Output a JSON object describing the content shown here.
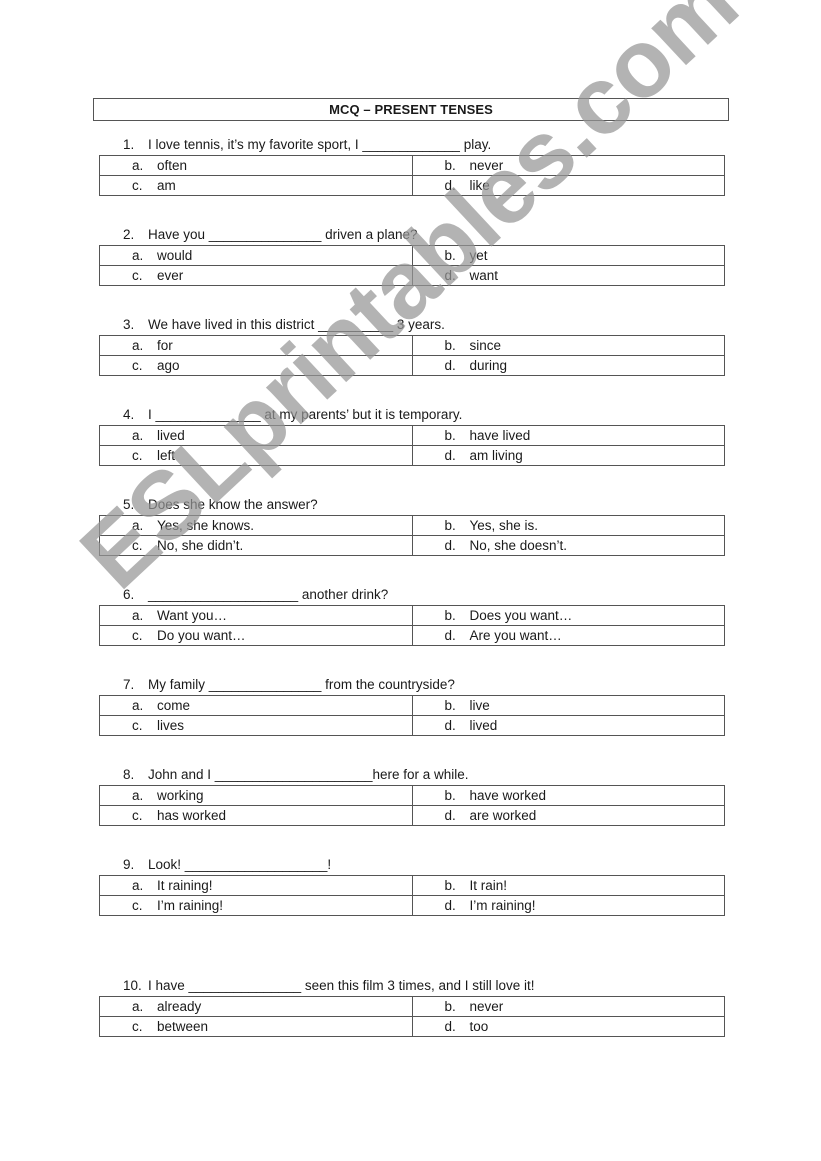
{
  "worksheet": {
    "title": "MCQ – PRESENT TENSES",
    "watermark": "ESLprintables.com",
    "questions": [
      {
        "number": "1.",
        "stem": "I love tennis, it’s my favorite sport, I _____________ play.",
        "options": [
          {
            "letter": "a.",
            "text": "often"
          },
          {
            "letter": "b.",
            "text": "never"
          },
          {
            "letter": "c.",
            "text": "am"
          },
          {
            "letter": "d.",
            "text": "like"
          }
        ]
      },
      {
        "number": "2.",
        "stem": "Have you _______________ driven a plane?",
        "options": [
          {
            "letter": "a.",
            "text": "would"
          },
          {
            "letter": "b.",
            "text": "yet"
          },
          {
            "letter": "c.",
            "text": "ever"
          },
          {
            "letter": "d.",
            "text": "want"
          }
        ]
      },
      {
        "number": "3.",
        "stem": "We have lived in this district __________ 3 years.",
        "options": [
          {
            "letter": "a.",
            "text": "for"
          },
          {
            "letter": "b.",
            "text": "since"
          },
          {
            "letter": "c.",
            "text": "ago"
          },
          {
            "letter": "d.",
            "text": "during"
          }
        ]
      },
      {
        "number": "4.",
        "stem": "I ______________ at my parents’ but it is temporary.",
        "options": [
          {
            "letter": "a.",
            "text": "lived"
          },
          {
            "letter": "b.",
            "text": "have lived"
          },
          {
            "letter": "c.",
            "text": "left"
          },
          {
            "letter": "d.",
            "text": "am living"
          }
        ]
      },
      {
        "number": "5.",
        "stem": "Does she know the answer?",
        "options": [
          {
            "letter": "a.",
            "text": "Yes, she knows."
          },
          {
            "letter": "b.",
            "text": "Yes, she is."
          },
          {
            "letter": "c.",
            "text": "No, she didn’t."
          },
          {
            "letter": "d.",
            "text": "No, she doesn’t."
          }
        ]
      },
      {
        "number": "6.",
        "stem": "____________________ another drink?",
        "options": [
          {
            "letter": "a.",
            "text": "Want you…"
          },
          {
            "letter": "b.",
            "text": "Does you want…"
          },
          {
            "letter": "c.",
            "text": "Do you want…"
          },
          {
            "letter": "d.",
            "text": "Are you want…"
          }
        ]
      },
      {
        "number": "7.",
        "stem": "My family _______________ from the countryside?",
        "options": [
          {
            "letter": "a.",
            "text": "come"
          },
          {
            "letter": "b.",
            "text": "live"
          },
          {
            "letter": "c.",
            "text": "lives"
          },
          {
            "letter": "d.",
            "text": "lived"
          }
        ]
      },
      {
        "number": "8.",
        "stem": "John and I _____________________here for a while.",
        "options": [
          {
            "letter": "a.",
            "text": "working"
          },
          {
            "letter": "b.",
            "text": "have worked"
          },
          {
            "letter": "c.",
            "text": "has worked"
          },
          {
            "letter": "d.",
            "text": "are worked"
          }
        ]
      },
      {
        "number": "9.",
        "stem": "Look! ___________________!",
        "options": [
          {
            "letter": "a.",
            "text": "It raining!"
          },
          {
            "letter": "b.",
            "text": "It rain!"
          },
          {
            "letter": "c.",
            "text": "I’m raining!"
          },
          {
            "letter": "d.",
            "text": "I’m raining!"
          }
        ]
      },
      {
        "number": "10.",
        "stem": "I have _______________ seen this film 3 times, and I still love it!",
        "options": [
          {
            "letter": "a.",
            "text": "already"
          },
          {
            "letter": "b.",
            "text": "never"
          },
          {
            "letter": "c.",
            "text": "between"
          },
          {
            "letter": "d.",
            "text": "too"
          }
        ]
      }
    ]
  }
}
